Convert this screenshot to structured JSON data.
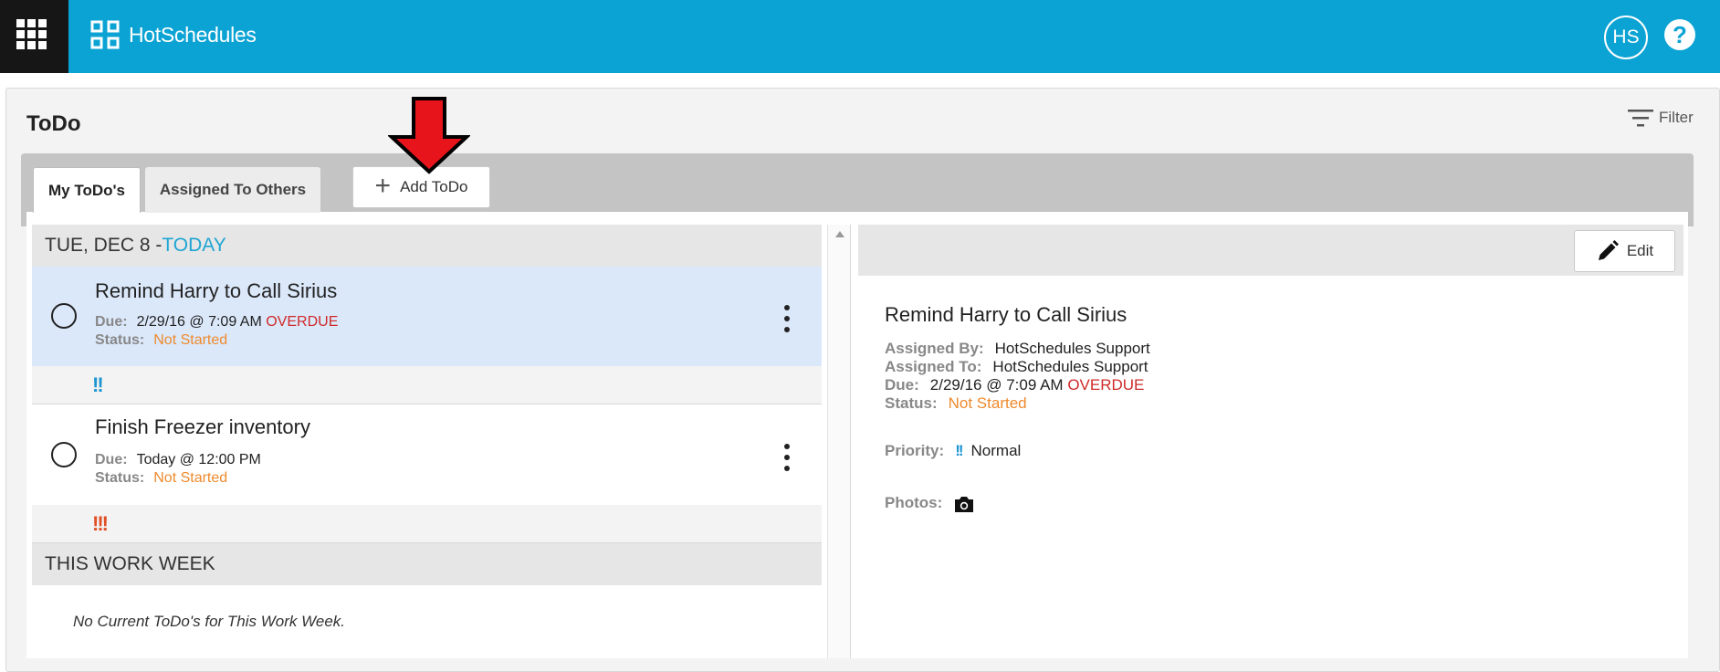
{
  "header": {
    "brand": "HotSchedules",
    "avatar_initials": "HS",
    "help_symbol": "?",
    "apps_icon": "grid-icon"
  },
  "page": {
    "title": "ToDo",
    "filter_label": "Filter"
  },
  "tabs": [
    {
      "label": "My ToDo's",
      "active": true
    },
    {
      "label": "Assigned To Others",
      "active": false
    }
  ],
  "add_button_label": "Add ToDo",
  "sections": {
    "today": {
      "day": "TUE, DEC 8 - ",
      "today_label": "TODAY"
    },
    "work_week": {
      "label": "THIS WORK WEEK",
      "empty_text": "No Current ToDo's for This Work Week."
    }
  },
  "labels": {
    "due": "Due:",
    "status": "Status:",
    "assigned_by": "Assigned By:",
    "assigned_to": "Assigned To:",
    "priority": "Priority:",
    "photos": "Photos:"
  },
  "todos": [
    {
      "title": "Remind Harry to Call Sirius",
      "due": "2/29/16 @ 7:09 AM",
      "overdue": "OVERDUE",
      "status": "Not Started",
      "priority_mark": "!!",
      "selected": true
    },
    {
      "title": "Finish Freezer inventory",
      "due": "Today @ 12:00 PM",
      "overdue": "",
      "status": "Not Started",
      "priority_mark": "!!!",
      "selected": false
    }
  ],
  "detail": {
    "edit_label": "Edit",
    "title": "Remind Harry to Call Sirius",
    "assigned_by": "HotSchedules Support",
    "assigned_to": "HotSchedules Support",
    "due": "2/29/16 @ 7:09 AM",
    "overdue": "OVERDUE",
    "status": "Not Started",
    "priority_mark": "!!",
    "priority": "Normal"
  },
  "colors": {
    "topbar": "#0ba3d4",
    "overdue": "#cf2a2a",
    "not_started": "#ee8a2d",
    "today": "#1ea5d3",
    "priority_normal": "#1e95d0",
    "priority_high": "#e04f25",
    "annotation_arrow": "#e8141c"
  }
}
